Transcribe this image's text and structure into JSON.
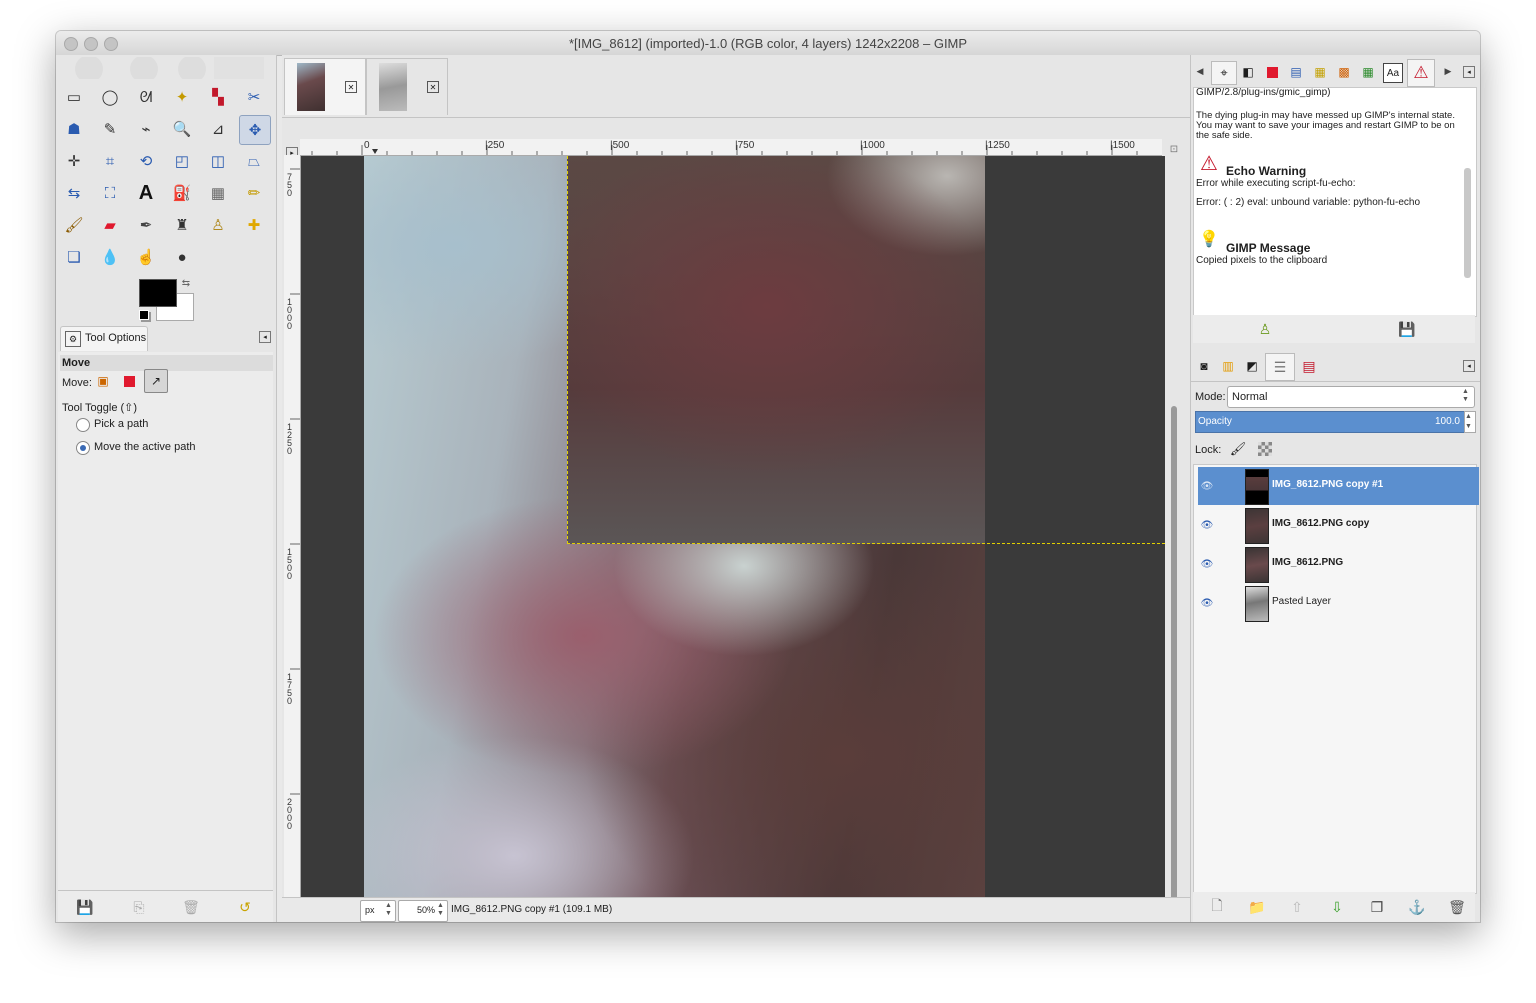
{
  "window": {
    "title": "*[IMG_8612] (imported)-1.0 (RGB color, 4 layers) 1242x2208 – GIMP"
  },
  "toolbox": {
    "tools": [
      {
        "name": "rect-select-icon",
        "glyph": "▭"
      },
      {
        "name": "ellipse-select-icon",
        "glyph": "◯"
      },
      {
        "name": "lasso-icon",
        "glyph": "ᘛ"
      },
      {
        "name": "fuzzy-select-icon",
        "glyph": "✦"
      },
      {
        "name": "color-select-icon",
        "glyph": "▚"
      },
      {
        "name": "scissors-icon",
        "glyph": "✂"
      },
      {
        "name": "foreground-select-icon",
        "glyph": "☗"
      },
      {
        "name": "paths-icon",
        "glyph": "✎"
      },
      {
        "name": "color-picker-icon",
        "glyph": "⌁"
      },
      {
        "name": "zoom-icon",
        "glyph": "🔍"
      },
      {
        "name": "measure-icon",
        "glyph": "⊿"
      },
      {
        "name": "move-icon",
        "glyph": "✥"
      },
      {
        "name": "align-icon",
        "glyph": "✛"
      },
      {
        "name": "crop-icon",
        "glyph": "⌗"
      },
      {
        "name": "rotate-icon",
        "glyph": "⟲"
      },
      {
        "name": "scale-icon",
        "glyph": "◰"
      },
      {
        "name": "shear-icon",
        "glyph": "◫"
      },
      {
        "name": "perspective-icon",
        "glyph": "⏢"
      },
      {
        "name": "flip-icon",
        "glyph": "⇆"
      },
      {
        "name": "cage-icon",
        "glyph": "⛶"
      },
      {
        "name": "text-icon",
        "glyph": "A"
      },
      {
        "name": "bucket-fill-icon",
        "glyph": "⛽"
      },
      {
        "name": "blend-icon",
        "glyph": "▦"
      },
      {
        "name": "pencil-icon",
        "glyph": "✏"
      },
      {
        "name": "paintbrush-icon",
        "glyph": "🖌"
      },
      {
        "name": "eraser-icon",
        "glyph": "▰"
      },
      {
        "name": "airbrush-icon",
        "glyph": "✒"
      },
      {
        "name": "ink-icon",
        "glyph": "♜"
      },
      {
        "name": "clone-icon",
        "glyph": "♙"
      },
      {
        "name": "heal-icon",
        "glyph": "✚"
      },
      {
        "name": "perspective-clone-icon",
        "glyph": "❏"
      },
      {
        "name": "blur-icon",
        "glyph": "💧"
      },
      {
        "name": "smudge-icon",
        "glyph": "☝"
      },
      {
        "name": "dodge-burn-icon",
        "glyph": "●"
      }
    ],
    "colors": {
      "foreground": "#000000",
      "background": "#ffffff"
    }
  },
  "tool_options": {
    "tab_label": "Tool Options",
    "heading": "Move",
    "move_label": "Move:",
    "toggle_label": "Tool Toggle  (⇧)",
    "option_pick": "Pick a path",
    "option_move": "Move the active path"
  },
  "image_tabs": [
    {
      "name": "image-tab-1",
      "active": true
    },
    {
      "name": "image-tab-2",
      "active": false
    }
  ],
  "ruler": {
    "h_ticks": [
      "0",
      "|250",
      "|500",
      "|750",
      "|1000",
      "|1250",
      "|1500"
    ],
    "v_ticks": [
      "750",
      "1000",
      "1250",
      "1500",
      "1750",
      "2000"
    ]
  },
  "statusbar": {
    "unit": "px",
    "zoom": "50%",
    "info": "IMG_8612.PNG copy #1 (109.1 MB)"
  },
  "messages": {
    "path_line": "GIMP/2.8/plug-ins/gmic_gimp)",
    "dying_text": "The dying plug-in may have messed up GIMP's internal state. You may want to save your images and restart GIMP to be on the safe side.",
    "echo_title": "Echo Warning",
    "echo_line1": "Error while executing script-fu-echo:",
    "echo_line2": "Error: ( : 2) eval: unbound variable: python-fu-echo",
    "gimp_title": "GIMP Message",
    "gimp_line": "Copied pixels to the clipboard"
  },
  "layers_panel": {
    "mode_label": "Mode:",
    "mode_value": "Normal",
    "opacity_label": "Opacity",
    "opacity_value": "100.0",
    "lock_label": "Lock:",
    "layers": [
      {
        "name": "IMG_8612.PNG copy #1",
        "bold": true,
        "selected": true
      },
      {
        "name": "IMG_8612.PNG copy",
        "bold": true,
        "selected": false
      },
      {
        "name": "IMG_8612.PNG",
        "bold": true,
        "selected": false
      },
      {
        "name": "Pasted Layer",
        "bold": false,
        "selected": false
      }
    ]
  },
  "accent": "#5b8fcf"
}
